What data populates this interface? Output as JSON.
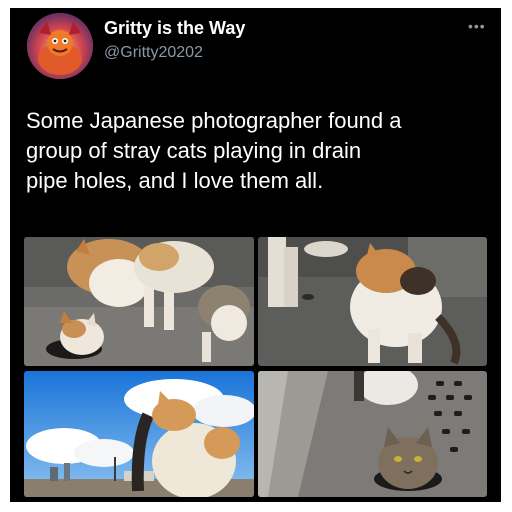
{
  "tweet": {
    "display_name": "Gritty is the Way",
    "handle": "@Gritty20202",
    "more_icon": "more-horizontal-icon",
    "text_lines": [
      "Some Japanese photographer found a",
      "group of stray cats playing in drain",
      "pipe holes, and I love them all."
    ]
  },
  "colors": {
    "card_background": "#000000",
    "text_primary": "#ffffff",
    "text_secondary": "#8b98a5",
    "page_background": "#ffffff"
  },
  "media": {
    "count": 4,
    "photos": [
      {
        "subject": "cats-around-drain-hole"
      },
      {
        "subject": "calico-cat-on-pavement"
      },
      {
        "subject": "cats-under-blue-sky"
      },
      {
        "subject": "tabby-cat-in-drain-hole"
      }
    ]
  }
}
